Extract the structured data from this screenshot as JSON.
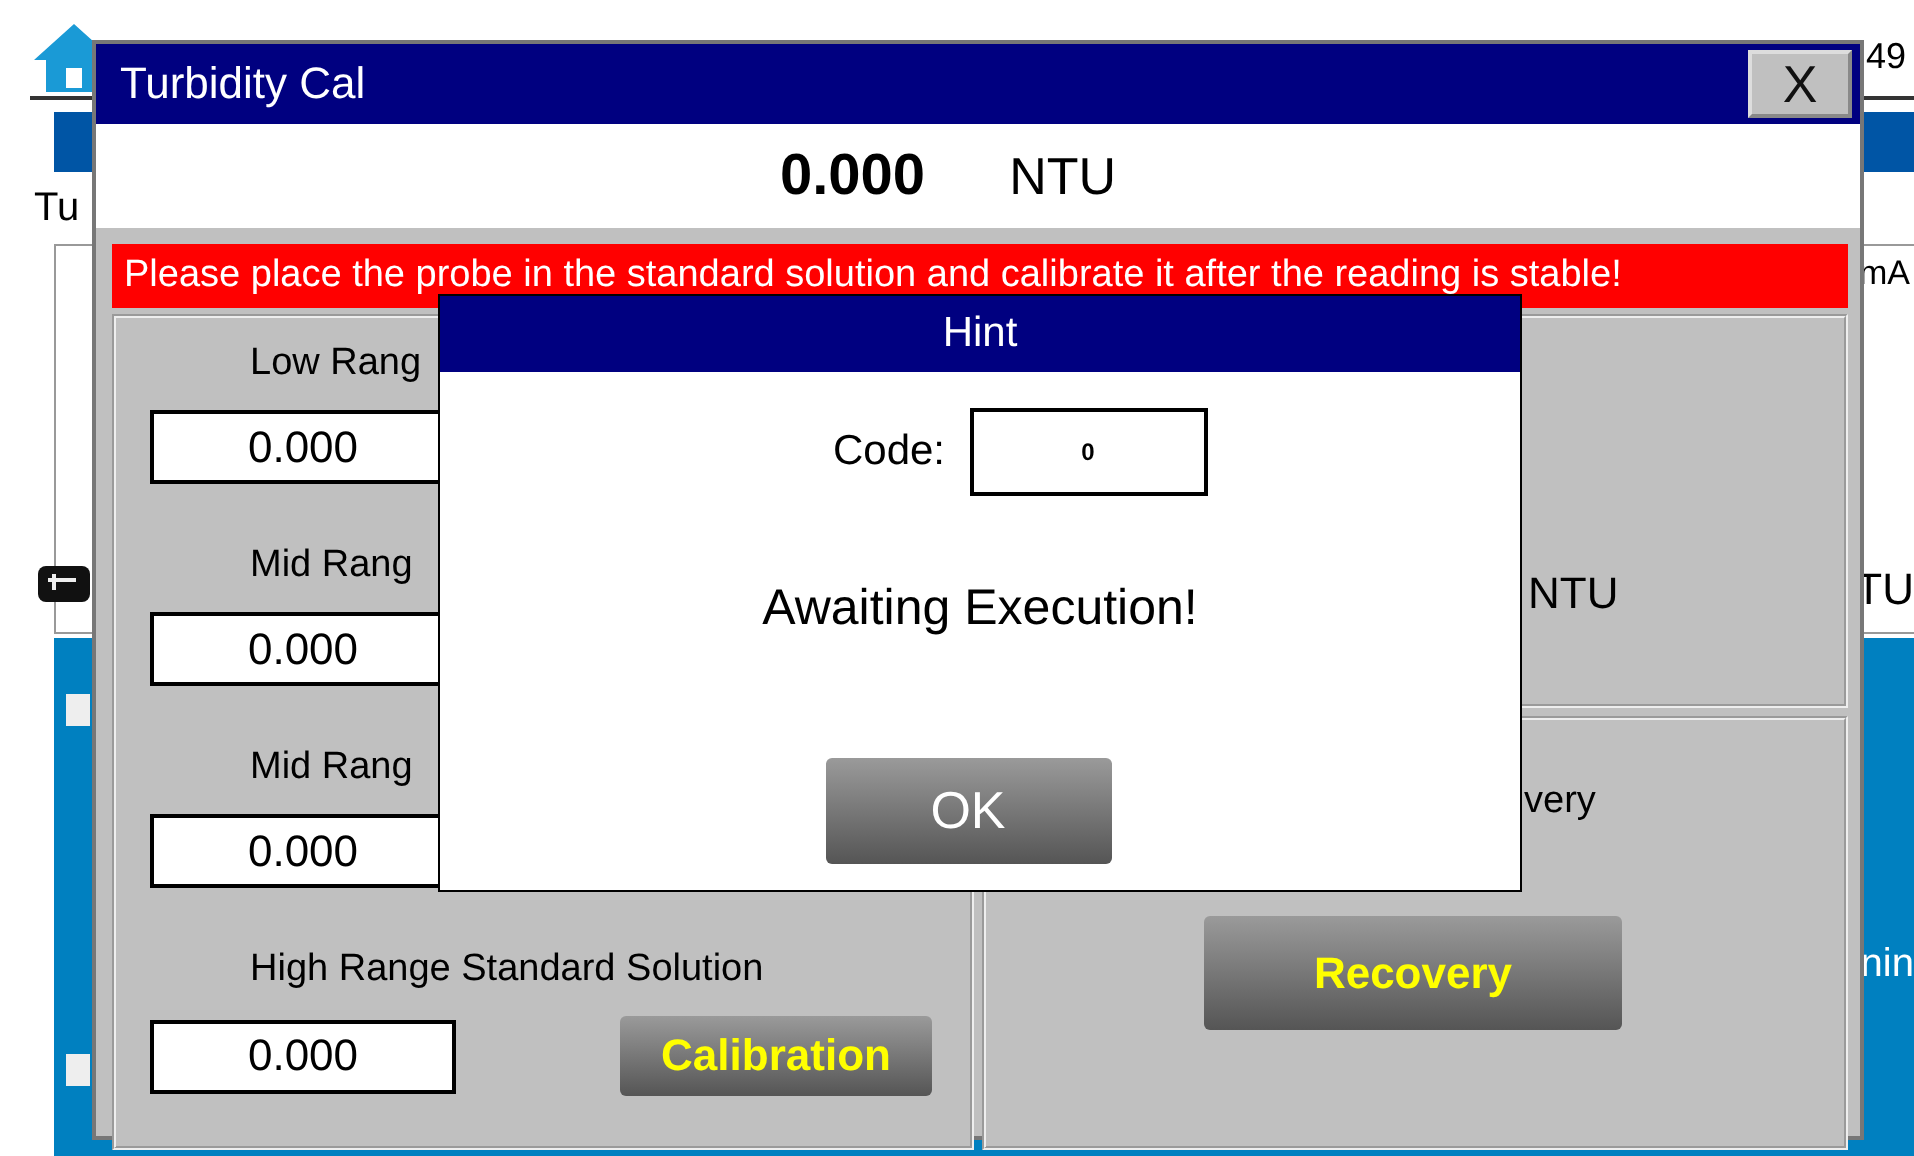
{
  "background_screen": {
    "header_value": "49",
    "tab_label": "Tu",
    "unit_top": "mA",
    "unit_mid": "TU",
    "unit_bottom": "nin",
    "checkboxes": [
      {
        "checked": false
      },
      {
        "checked": false
      }
    ]
  },
  "calibration_dialog": {
    "title": "Turbidity Cal",
    "close_button": "X",
    "reading": "0.000",
    "unit": "NTU",
    "notice": "Please place the probe in the standard solution and calibrate it after the reading is stable!",
    "standards": [
      {
        "label": "Low Rang",
        "value": "0.000"
      },
      {
        "label": "Mid Rang",
        "value": "0.000"
      },
      {
        "label": "Mid Rang",
        "value": "0.000"
      },
      {
        "label": "High Range Standard Solution",
        "value": "0.000"
      }
    ],
    "calibration_button": "Calibration",
    "right_unit": "NTU",
    "recovery_label": "very",
    "recovery_button": "Recovery"
  },
  "hint_dialog": {
    "title": "Hint",
    "code_label": "Code:",
    "code_value": "0",
    "message": "Awaiting Execution!",
    "ok_button": "OK"
  }
}
